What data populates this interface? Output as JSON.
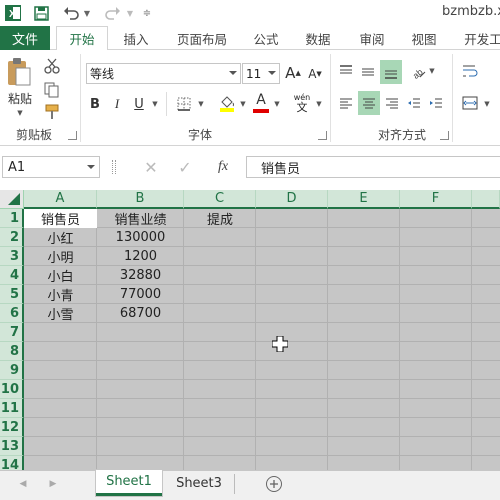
{
  "window": {
    "title": "bzmbzb.xlsx"
  },
  "tabs": [
    {
      "label": "文件"
    },
    {
      "label": "开始"
    },
    {
      "label": "插入"
    },
    {
      "label": "页面布局"
    },
    {
      "label": "公式"
    },
    {
      "label": "数据"
    },
    {
      "label": "审阅"
    },
    {
      "label": "视图"
    },
    {
      "label": "开发工"
    }
  ],
  "ribbon": {
    "paste_label": "粘贴",
    "font_name": "等线",
    "font_size": "11",
    "increase_font": "A",
    "decrease_font": "A",
    "bold": "B",
    "italic": "I",
    "underline": "U",
    "font_color_glyph": "A",
    "phonetic_top": "wén",
    "phonetic_bottom": "文",
    "groups": {
      "clipboard": "剪贴板",
      "font": "字体",
      "alignment": "对齐方式"
    }
  },
  "formula_bar": {
    "name_box": "A1",
    "fx": "fx",
    "value": "销售员"
  },
  "grid": {
    "columns": [
      "A",
      "B",
      "C",
      "D",
      "E",
      "F"
    ],
    "rows": [
      "1",
      "2",
      "3",
      "4",
      "5",
      "6",
      "7",
      "8",
      "9",
      "10",
      "11",
      "12",
      "13",
      "14"
    ],
    "header_row": [
      "销售员",
      "销售业绩",
      "提成"
    ],
    "data": [
      [
        "小红",
        "130000"
      ],
      [
        "小明",
        "1200"
      ],
      [
        "小白",
        "32880"
      ],
      [
        "小青",
        "77000"
      ],
      [
        "小雪",
        "68700"
      ]
    ]
  },
  "sheets": [
    "Sheet1",
    "Sheet3"
  ],
  "colors": {
    "accent": "#217346",
    "selection": "#c6c6c6"
  }
}
